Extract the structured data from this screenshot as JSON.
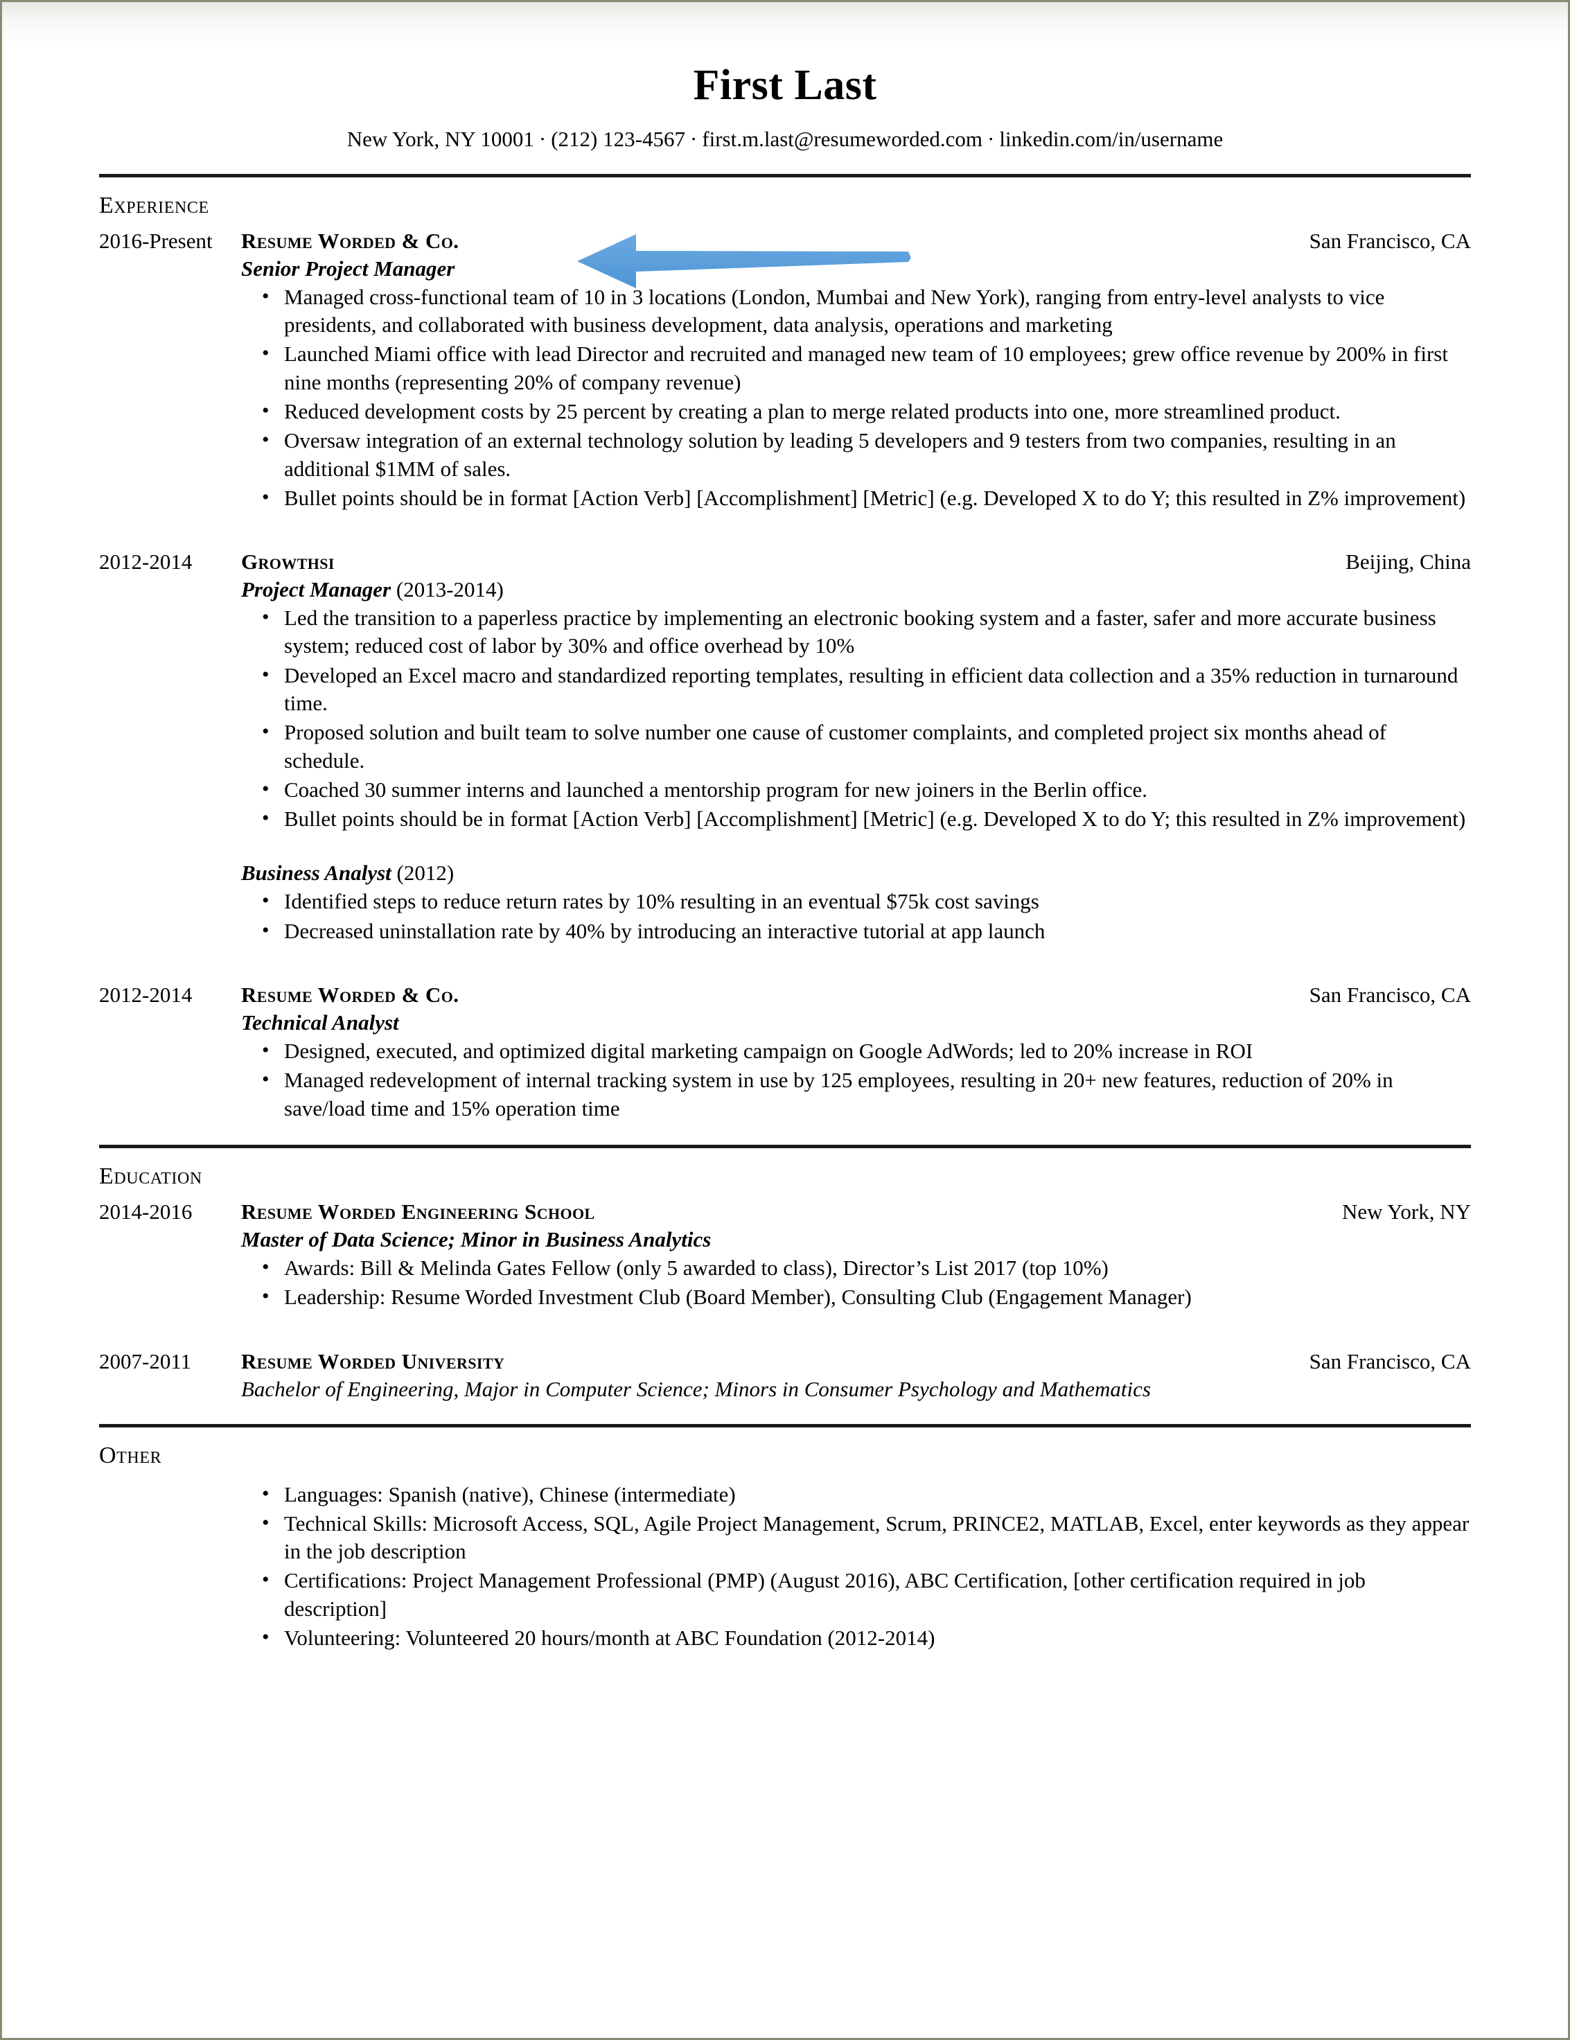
{
  "document": {
    "type": "resume",
    "name": "First Last",
    "contact": {
      "location": "New York, NY 10001",
      "phone": "(212) 123-4567",
      "email": "first.m.last@resumeworded.com",
      "linkedin": "linkedin.com/in/username",
      "separator": "·"
    }
  },
  "annotation": {
    "type": "arrow",
    "direction": "left",
    "color": "#5B9BD5",
    "points_to": "Senior Project Manager"
  },
  "sections": {
    "experience": {
      "heading": "Experience",
      "entries": [
        {
          "dates": "2016-Present",
          "organization": "Resume Worded & Co.",
          "location": "San Francisco, CA",
          "title": "Senior Project Manager",
          "title_years": "",
          "bullets": [
            "Managed cross-functional team of 10 in 3 locations (London, Mumbai and New York), ranging from entry-level analysts to vice presidents, and collaborated with business development, data analysis, operations and marketing",
            "Launched Miami office with lead Director and recruited and managed new team of 10 employees; grew office revenue by 200% in first nine months (representing 20% of company revenue)",
            "Reduced development costs by 25 percent by creating a plan to merge related products into one, more streamlined product.",
            "Oversaw integration of an external technology solution by leading 5 developers and 9 testers from two companies, resulting in an additional $1MM of sales.",
            "Bullet points should be in format [Action Verb] [Accomplishment] [Metric] (e.g. Developed X to do Y; this resulted in Z% improvement)"
          ]
        },
        {
          "dates": "2012-2014",
          "organization": "Growthsi",
          "location": "Beijing, China",
          "title": "Project Manager",
          "title_years": " (2013-2014)",
          "bullets": [
            "Led the transition to a paperless practice by implementing an electronic booking system and a faster, safer and more accurate business system; reduced cost of labor by 30% and office overhead by 10%",
            "Developed an Excel macro and standardized reporting templates, resulting in efficient data collection and a 35% reduction in turnaround time.",
            "Proposed solution and built team to solve number one cause of customer complaints, and completed project six months ahead of schedule.",
            "Coached 30 summer interns and launched a mentorship program for new joiners in the Berlin office.",
            "Bullet points should be in format [Action Verb] [Accomplishment] [Metric] (e.g. Developed X to do Y; this resulted in Z% improvement)"
          ],
          "subrole": {
            "title": "Business Analyst",
            "title_years": " (2012)",
            "bullets": [
              "Identified steps to reduce return rates by 10% resulting in an eventual $75k cost savings",
              "Decreased uninstallation rate by 40% by introducing an interactive tutorial at app launch"
            ]
          }
        },
        {
          "dates": "2012-2014",
          "organization": "Resume Worded & Co.",
          "location": "San Francisco, CA",
          "title": "Technical Analyst",
          "title_years": "",
          "bullets": [
            "Designed, executed, and optimized digital marketing campaign on Google AdWords; led to 20% increase in ROI",
            "Managed redevelopment of internal tracking system in use by 125 employees, resulting in 20+ new features, reduction of 20% in save/load time and 15% operation time"
          ]
        }
      ]
    },
    "education": {
      "heading": "Education",
      "entries": [
        {
          "dates": "2014-2016",
          "organization": "Resume Worded Engineering School",
          "location": "New York, NY",
          "title": "Master of Data Science; Minor in Business Analytics",
          "bullets": [
            "Awards: Bill & Melinda Gates Fellow (only 5 awarded to class), Director’s List 2017 (top 10%)",
            "Leadership: Resume Worded Investment Club (Board Member), Consulting Club (Engagement Manager)"
          ]
        },
        {
          "dates": "2007-2011",
          "organization": "Resume Worded University",
          "location": "San Francisco, CA",
          "title": "Bachelor of Engineering, Major in Computer Science; Minors in Consumer Psychology and Mathematics",
          "bullets": []
        }
      ]
    },
    "other": {
      "heading": "Other",
      "bullets": [
        "Languages: Spanish (native), Chinese (intermediate)",
        "Technical Skills: Microsoft Access, SQL, Agile Project Management, Scrum, PRINCE2, MATLAB, Excel, enter keywords as they appear in the job description",
        "Certifications: Project Management Professional (PMP) (August 2016), ABC Certification, [other certification required in job description]",
        "Volunteering: Volunteered 20 hours/month at ABC Foundation (2012-2014)"
      ]
    }
  }
}
